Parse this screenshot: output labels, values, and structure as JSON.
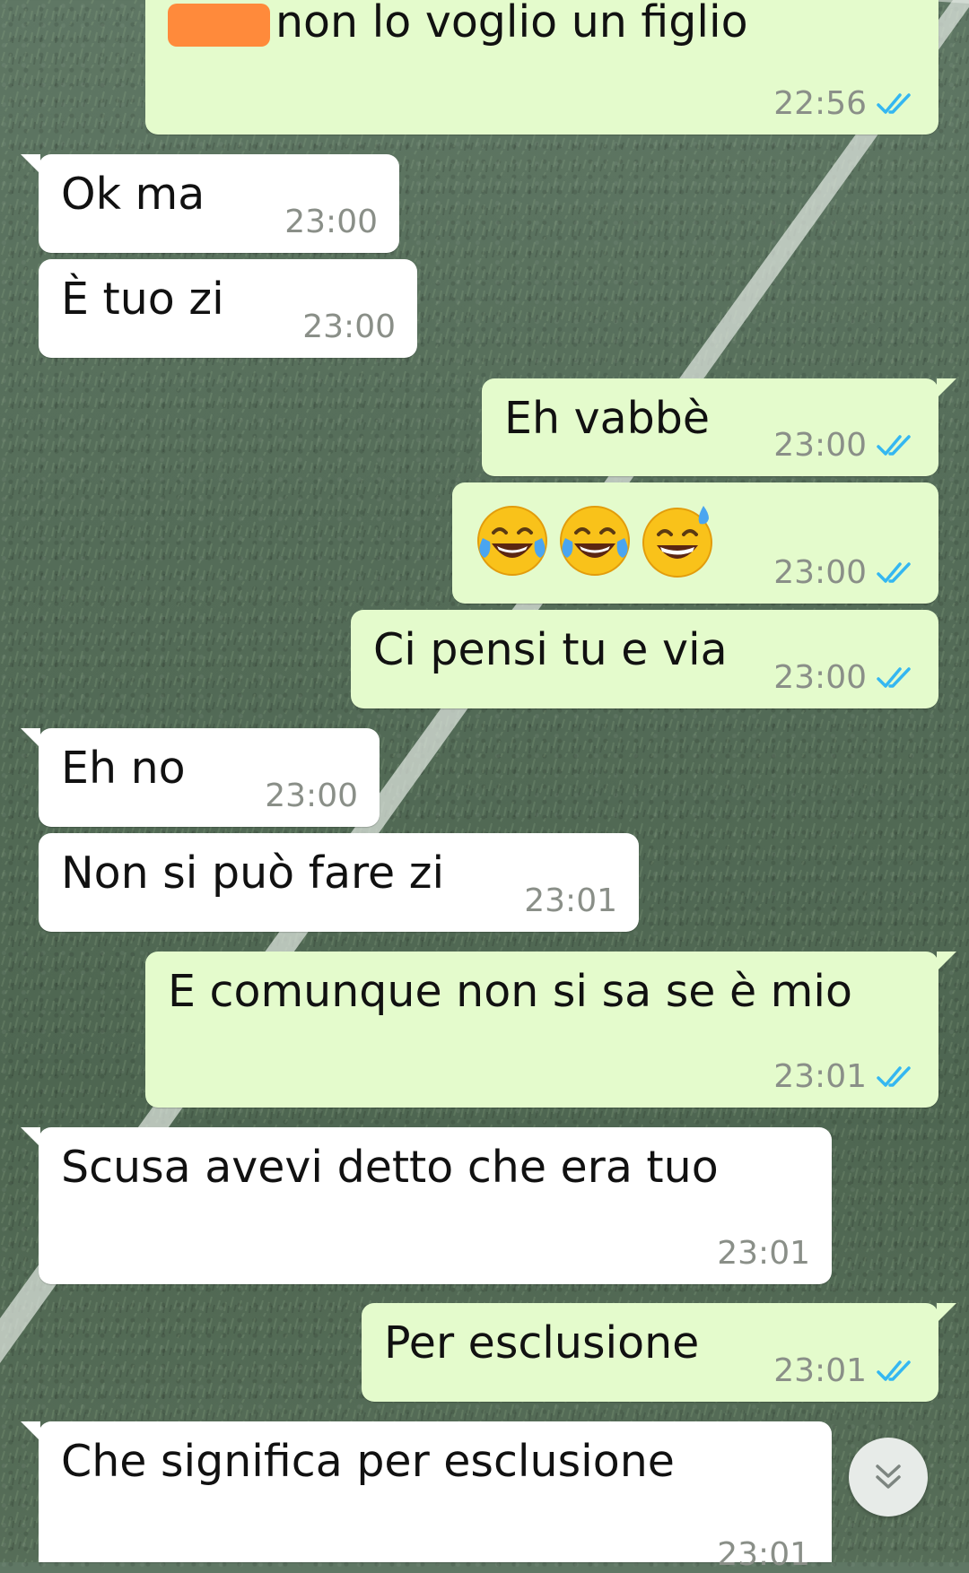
{
  "messages": [
    {
      "id": "m1",
      "side": "out",
      "text": "non lo voglio un figlio",
      "time": "22:56",
      "status": "read",
      "redacted_prefix": true
    },
    {
      "id": "m2",
      "side": "in",
      "text": "Ok ma",
      "time": "23:00"
    },
    {
      "id": "m3",
      "side": "in",
      "text": "È tuo zi",
      "time": "23:00"
    },
    {
      "id": "m4",
      "side": "out",
      "text": "Eh vabbè",
      "time": "23:00",
      "status": "read"
    },
    {
      "id": "m5",
      "side": "out",
      "emojis": [
        "face-with-tears-of-joy",
        "face-with-tears-of-joy",
        "grinning-face-with-sweat"
      ],
      "time": "23:00",
      "status": "read"
    },
    {
      "id": "m6",
      "side": "out",
      "text": "Ci pensi tu e via",
      "time": "23:00",
      "status": "read"
    },
    {
      "id": "m7",
      "side": "in",
      "text": "Eh no",
      "time": "23:00"
    },
    {
      "id": "m8",
      "side": "in",
      "text": "Non si può fare zi",
      "time": "23:01"
    },
    {
      "id": "m9",
      "side": "out",
      "text": "E comunque non si sa se è mio",
      "time": "23:01",
      "status": "read"
    },
    {
      "id": "m10",
      "side": "in",
      "text": "Scusa avevi detto che era tuo",
      "time": "23:01"
    },
    {
      "id": "m11",
      "side": "out",
      "text": "Per esclusione",
      "time": "23:01",
      "status": "read"
    },
    {
      "id": "m12",
      "side": "in",
      "text": "Che significa per esclusione",
      "time": "23:01"
    }
  ],
  "scroll_button": {
    "icon": "double-chevron-down-icon"
  },
  "colors": {
    "incoming": "#ffffff",
    "outgoing": "#e4fbcc",
    "read_ticks": "#34b7f1",
    "redaction": "#ff8a3b"
  }
}
